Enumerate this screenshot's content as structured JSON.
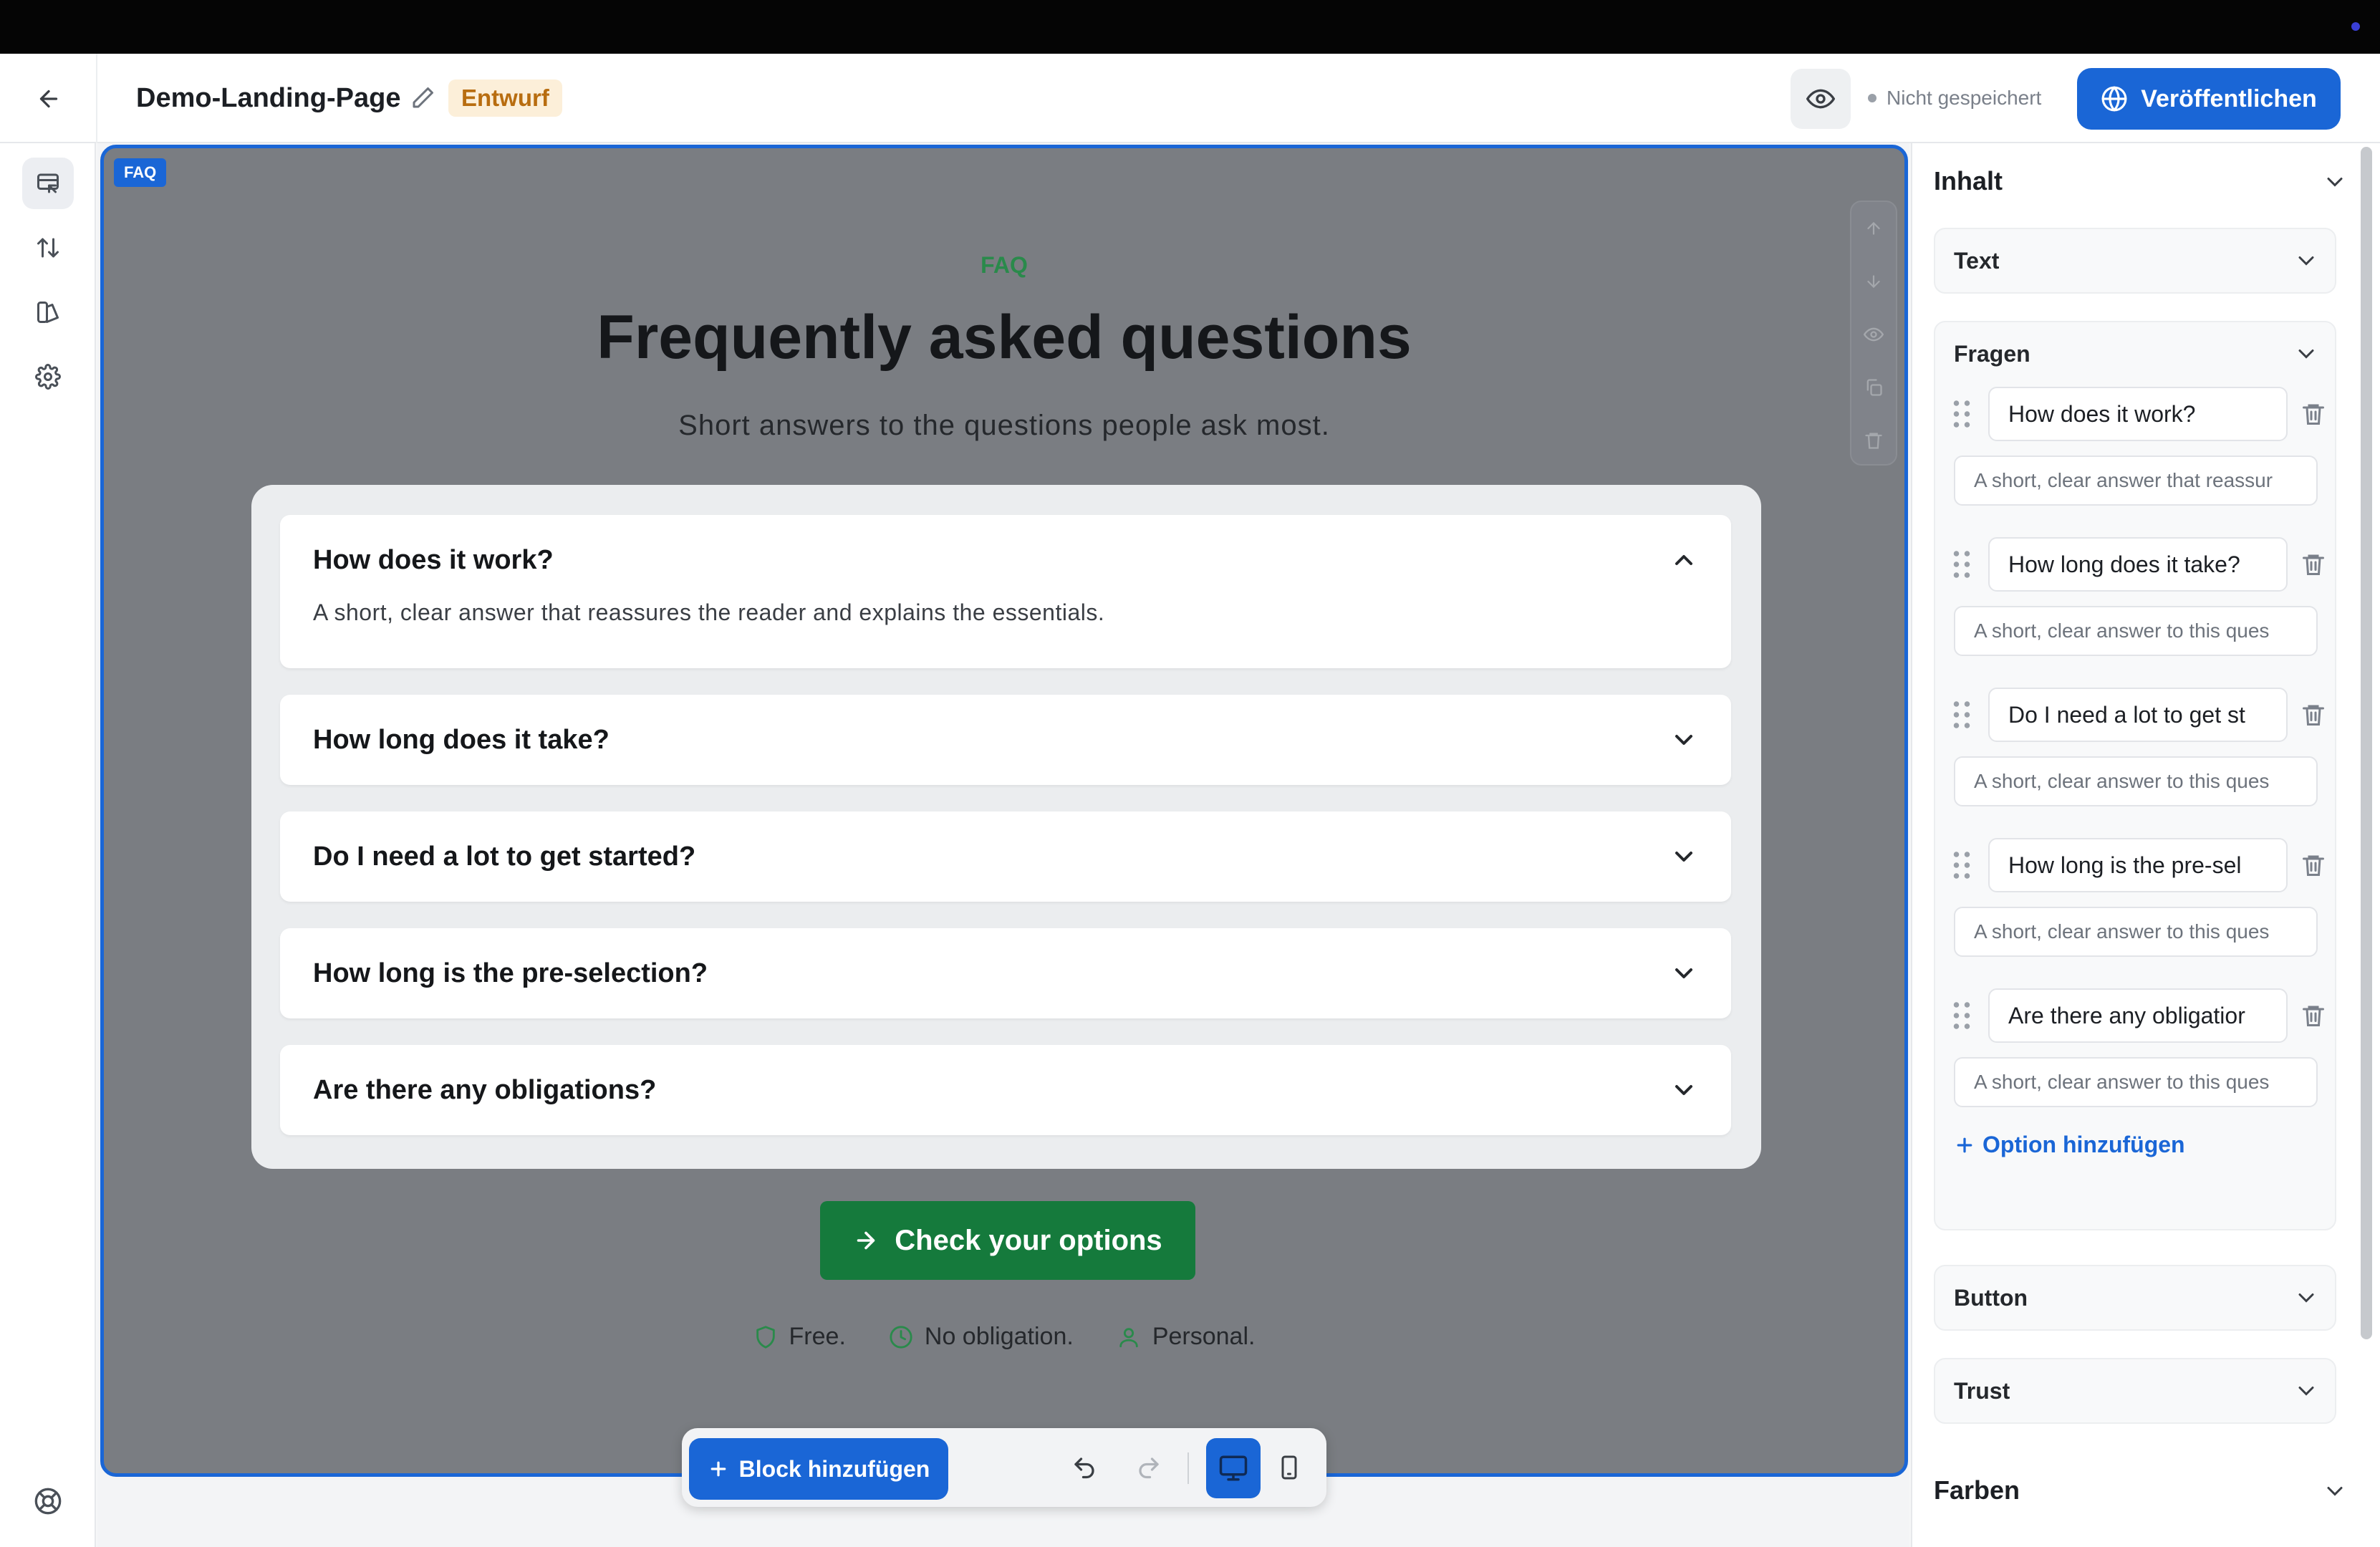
{
  "header": {
    "page_name": "Demo-Landing-Page",
    "status_badge": "Entwurf",
    "save_status": "Nicht gespeichert",
    "publish_label": "Veröffentlichen"
  },
  "canvas": {
    "block_tag": "FAQ",
    "eyebrow": "FAQ",
    "headline": "Frequently asked questions",
    "subline": "Short answers to the questions people ask most.",
    "faqs": [
      {
        "question": "How does it work?",
        "answer": "A short, clear answer that reassures the reader and explains the essentials.",
        "expanded": true
      },
      {
        "question": "How long does it take?",
        "expanded": false
      },
      {
        "question": "Do I need a lot to get started?",
        "expanded": false
      },
      {
        "question": "How long is the pre-selection?",
        "expanded": false
      },
      {
        "question": "Are there any obligations?",
        "expanded": false
      }
    ],
    "cta_label": "Check your options",
    "trust": [
      "Free.",
      "No obligation.",
      "Personal."
    ]
  },
  "toolbar": {
    "add_block_label": "Block hinzufügen"
  },
  "sidebar": {
    "content_heading": "Inhalt",
    "text_section": "Text",
    "questions_section": "Fragen",
    "question_inputs": [
      {
        "q": "How does it work?",
        "a": "A short, clear answer that reassur"
      },
      {
        "q": "How long does it take?",
        "a": "A short, clear answer to this ques"
      },
      {
        "q": "Do I need a lot to get st",
        "a": "A short, clear answer to this ques"
      },
      {
        "q": "How long is the pre-sel",
        "a": "A short, clear answer to this ques"
      },
      {
        "q": "Are there any obligatior",
        "a": "A short, clear answer to this ques"
      }
    ],
    "add_option_label": "Option hinzufügen",
    "button_section": "Button",
    "trust_section": "Trust",
    "colors_heading": "Farben"
  },
  "colors": {
    "accent": "#1a66d6",
    "green": "#157a3c",
    "overlay": "#7a7d82",
    "draft_bg": "#fcefd9",
    "draft_text": "#b86d10"
  }
}
